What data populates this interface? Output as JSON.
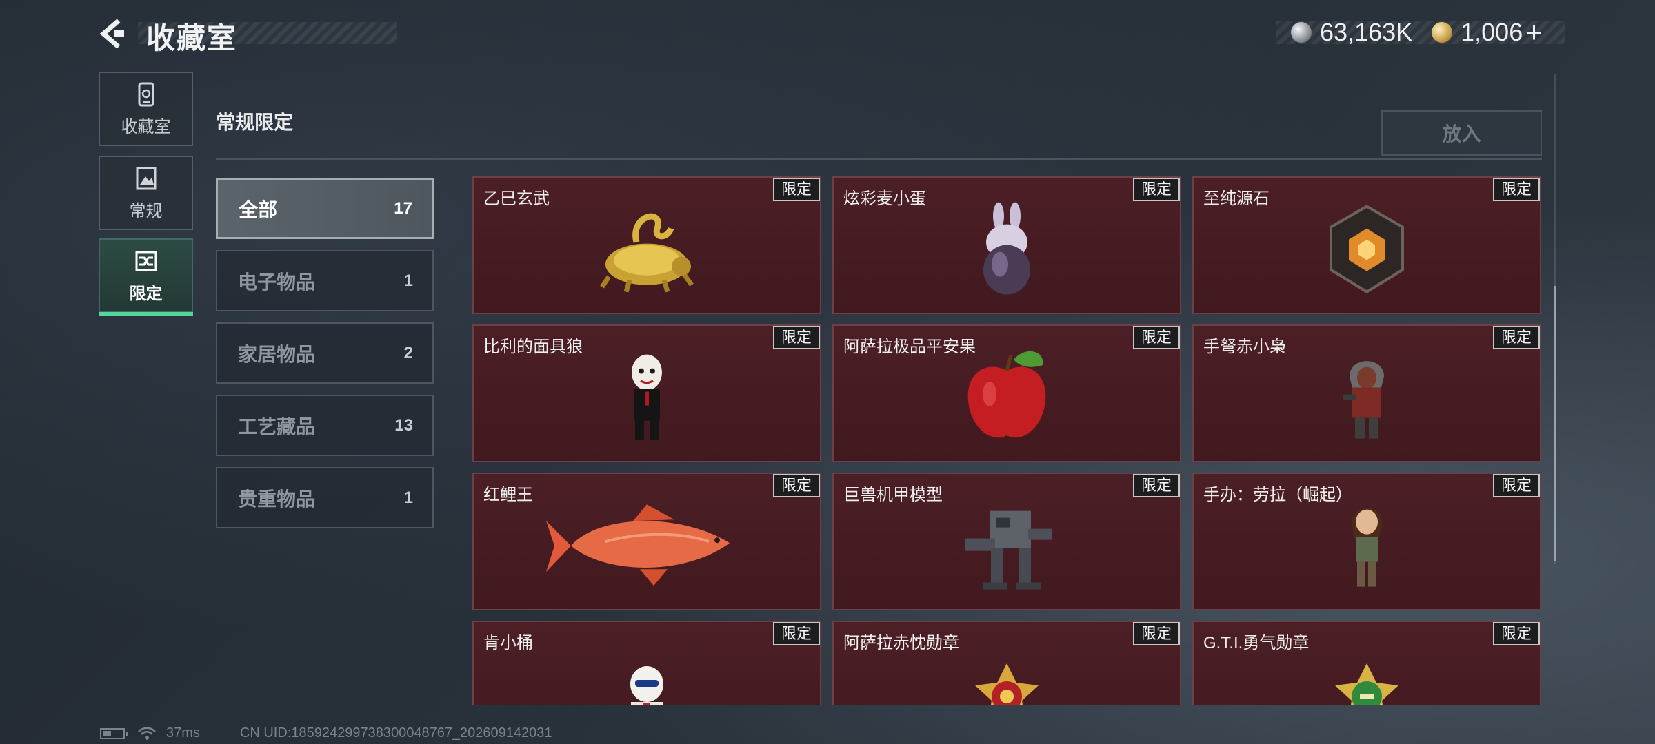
{
  "header": {
    "title": "收藏室",
    "currency": [
      {
        "icon": "silver-coin-icon",
        "value": "63,163K"
      },
      {
        "icon": "gold-coin-icon",
        "value": "1,006"
      }
    ],
    "plus_label": "+"
  },
  "sidebar": {
    "items": [
      {
        "label": "收藏室",
        "icon": "collection-room-icon",
        "active": false
      },
      {
        "label": "常规",
        "icon": "regular-icon",
        "active": false
      },
      {
        "label": "限定",
        "icon": "limited-icon",
        "active": true
      }
    ]
  },
  "section": {
    "title": "常规限定",
    "put_in_label": "放入"
  },
  "categories": [
    {
      "label": "全部",
      "count": "17",
      "active": true
    },
    {
      "label": "电子物品",
      "count": "1",
      "active": false
    },
    {
      "label": "家居物品",
      "count": "2",
      "active": false
    },
    {
      "label": "工艺藏品",
      "count": "13",
      "active": false
    },
    {
      "label": "贵重物品",
      "count": "1",
      "active": false
    }
  ],
  "items": [
    {
      "name": "乙巳玄武",
      "badge": "限定",
      "art": "golden-dragon-turtle-icon"
    },
    {
      "name": "炫彩麦小蛋",
      "badge": "限定",
      "art": "iridescent-bunny-egg-icon"
    },
    {
      "name": "至纯源石",
      "badge": "限定",
      "art": "glowing-crystal-stone-icon"
    },
    {
      "name": "比利的面具狼",
      "badge": "限定",
      "art": "puppet-mask-figure-icon"
    },
    {
      "name": "阿萨拉极品平安果",
      "badge": "限定",
      "art": "red-apple-icon"
    },
    {
      "name": "手弩赤小枭",
      "badge": "限定",
      "art": "hooded-crossbow-figure-icon"
    },
    {
      "name": "红鲤王",
      "badge": "限定",
      "art": "red-carp-fish-icon"
    },
    {
      "name": "巨兽机甲模型",
      "badge": "限定",
      "art": "mech-model-icon"
    },
    {
      "name": "手办：劳拉（崛起）",
      "badge": "限定",
      "art": "lara-figure-icon"
    },
    {
      "name": "肯小桶",
      "badge": "限定",
      "art": "colonel-figure-icon"
    },
    {
      "name": "阿萨拉赤忱勋章",
      "badge": "限定",
      "art": "red-gold-medal-icon"
    },
    {
      "name": "G.T.I.勇气勋章",
      "badge": "限定",
      "art": "green-gold-medal-icon"
    }
  ],
  "status": {
    "ping": "37ms",
    "uid": "CN UID:185924299738300048767_202609142031"
  }
}
